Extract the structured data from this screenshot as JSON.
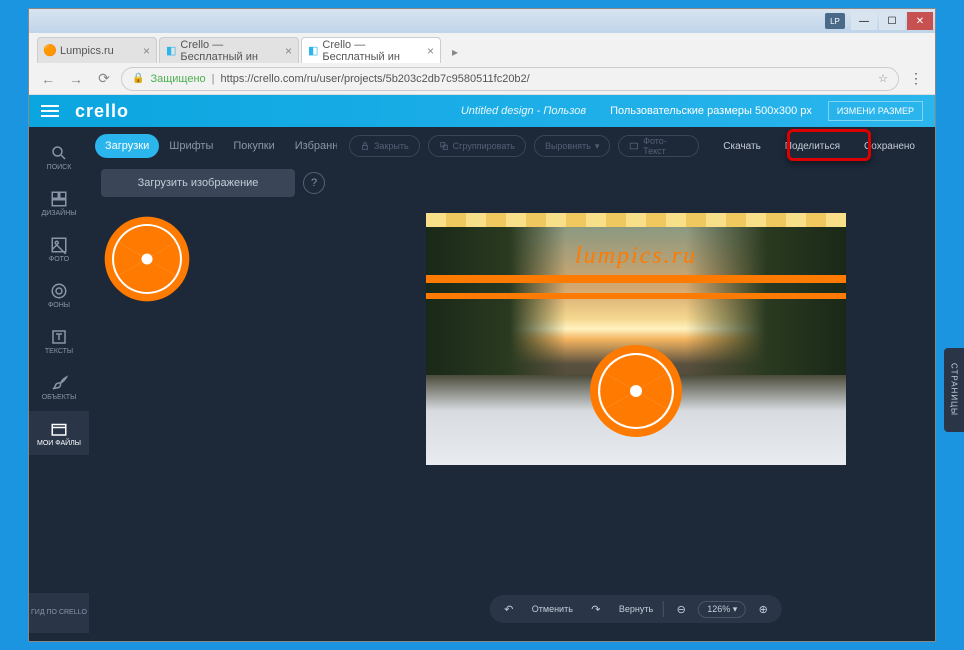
{
  "os": {
    "badge": "LP"
  },
  "browser": {
    "tabs": [
      {
        "title": "Lumpics.ru"
      },
      {
        "title": "Crello — Бесплатный ин"
      },
      {
        "title": "Crello — Бесплатный ин"
      }
    ],
    "secure": "Защищено",
    "url": "https://crello.com/ru/user/projects/5b203c2db7c9580511fc20b2/"
  },
  "header": {
    "logo": "crello",
    "doc_title": "Untitled design - Пользов",
    "size_text": "Пользовательские размеры 500x300 px",
    "resize": "ИЗМЕНИ РАЗМЕР"
  },
  "sidebar": {
    "items": [
      {
        "label": "ПОИСК"
      },
      {
        "label": "ДИЗАЙНЫ"
      },
      {
        "label": "ФОТО"
      },
      {
        "label": "ФОНЫ"
      },
      {
        "label": "ТЕКСТЫ"
      },
      {
        "label": "ОБЪЕКТЫ"
      },
      {
        "label": "МОИ ФАЙЛЫ"
      }
    ],
    "guide": "ГИД ПО CRELLO"
  },
  "panel": {
    "tabs": [
      {
        "label": "Загрузки"
      },
      {
        "label": "Шрифты"
      },
      {
        "label": "Покупки"
      },
      {
        "label": "Избранное"
      }
    ],
    "upload": "Загрузить изображение"
  },
  "toolbar": {
    "lock": "Закрыть",
    "group": "Сгруппировать",
    "align": "Выровнять",
    "phototext": "Фото-Текст",
    "download": "Скачать",
    "share": "Поделиться",
    "saved": "Сохранено"
  },
  "canvas": {
    "title": "lumpics.ru"
  },
  "bottom": {
    "undo": "Отменить",
    "redo": "Вернуть",
    "zoom": "126% ▾"
  },
  "pages_tab": "СТРАНИЦЫ"
}
